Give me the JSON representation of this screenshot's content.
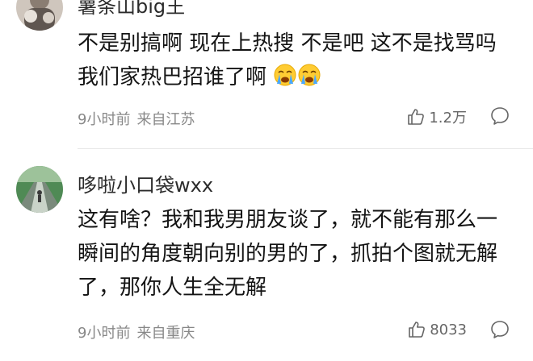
{
  "comments": [
    {
      "username": "薯条山big王",
      "text": "不是别搞啊 现在上热搜 不是吧 这不是找骂吗 我们家热巴招谁了啊",
      "time": "9小时前",
      "location": "来自江苏",
      "likes": "1.2万",
      "reaction_icons": [
        "crying-face-icon",
        "crying-face-icon"
      ]
    },
    {
      "username": "哆啦小口袋wxx",
      "text": "这有啥？我和我男朋友谈了，就不能有那么一瞬间的角度朝向别的男的了，抓拍个图就无解了，那你人生全无解",
      "time": "9小时前",
      "location": "来自重庆",
      "likes": "8033"
    }
  ],
  "colors": {
    "text": "#141414",
    "meta": "#888888",
    "divider": "#e8e8e8"
  }
}
